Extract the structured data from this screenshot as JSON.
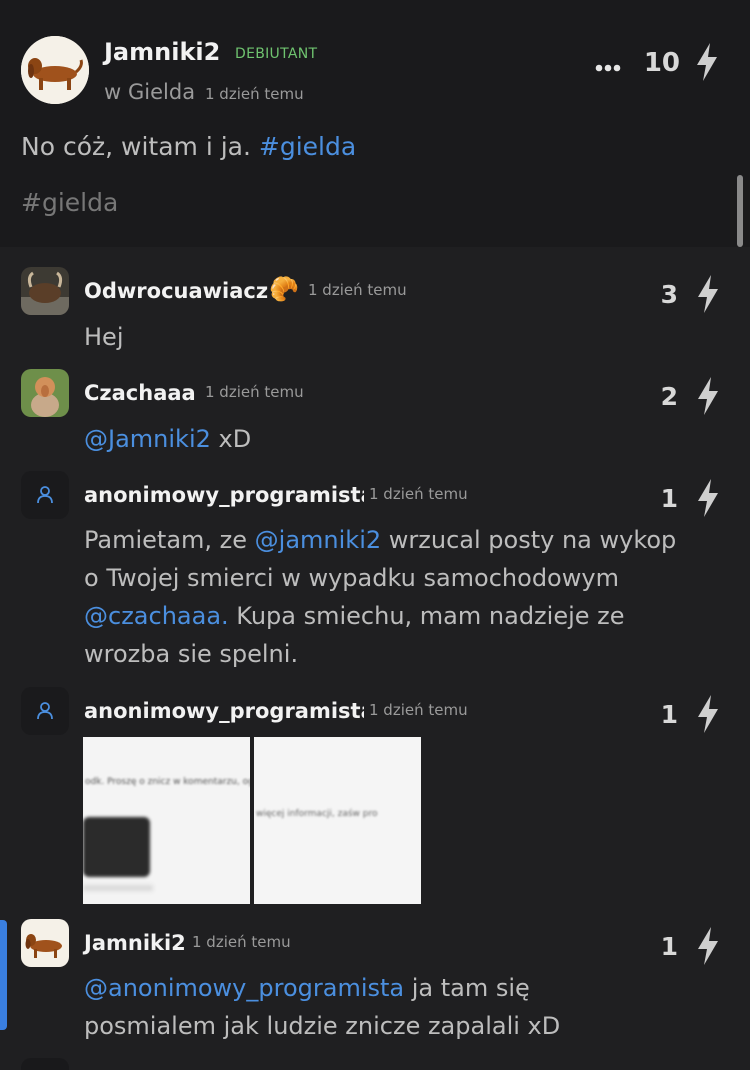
{
  "post": {
    "author": "Jamniki2",
    "badge": "DEBIUTANT",
    "community_prefix": "w",
    "community": "Gielda",
    "time": "1 dzień temu",
    "score": "10",
    "text_before": "No cóż, witam i ja.",
    "text_tag": "#gielda",
    "tag_line": "#gielda"
  },
  "comments": [
    {
      "author": "Odwrocuawiacz",
      "emoji": "🥐",
      "time": "1 dzień temu",
      "score": "3",
      "text": "Hej"
    },
    {
      "author": "Czachaaa",
      "time": "1 dzień temu",
      "score": "2",
      "mention": "@Jamniki2",
      "text_after": "xD"
    },
    {
      "author": "anonimowy_programista",
      "time": "1 dzień temu",
      "score": "1",
      "line1_pre": "Pamietam, ze ",
      "line1_mention": "@jamniki2",
      "line1_post": " wrzucal posty na wykop",
      "line2": "o Twojej smierci w wypadku samochodowym",
      "line3_mention": "@czachaaa.",
      "line3_post": " Kupa smiechu, mam nadzieje ze",
      "line4": "wrozba sie spelni."
    },
    {
      "author": "anonimowy_programista",
      "time": "1 dzień temu",
      "score": "1",
      "image1_text": "odk. Proszę o znicz w komentarzu, og",
      "image1_footer": "",
      "image2_text": "więcej informacji, zaśw pro"
    },
    {
      "author": "Jamniki2",
      "time": "1 dzień temu",
      "score": "1",
      "mention": "@anonimowy_programista",
      "line1_post": " ja tam się",
      "line2": "posmialem jak ludzie znicze zapalali xD"
    }
  ],
  "icons": {
    "more": "more-dots-icon",
    "vote": "lightning-bolt-icon",
    "anon": "user-icon"
  },
  "colors": {
    "background": "#1f1f21",
    "post_background": "#1a1a1c",
    "mention": "#4b8fdf",
    "badge": "#6fc36f",
    "highlight_bar": "#3a7fe0"
  }
}
